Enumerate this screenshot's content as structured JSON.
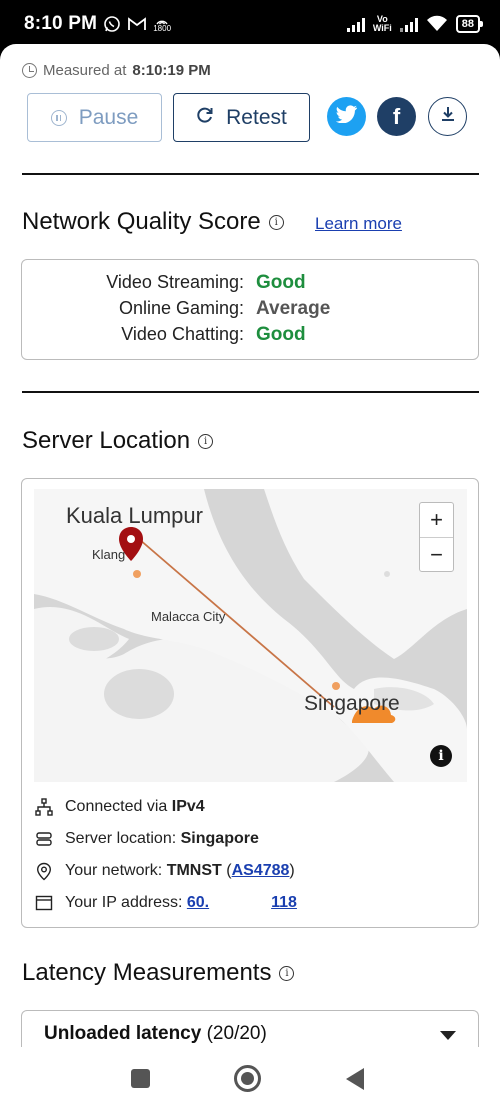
{
  "status_bar": {
    "time": "8:10 PM",
    "network_label": "1800",
    "vowifi_top": "Vo",
    "vowifi_bottom": "WiFi",
    "battery": "88"
  },
  "measured": {
    "prefix": "Measured at",
    "time": "8:10:19 PM"
  },
  "toolbar": {
    "pause_label": "Pause",
    "retest_label": "Retest",
    "facebook_glyph": "f"
  },
  "quality": {
    "title": "Network Quality Score",
    "learn_more": "Learn more",
    "rows": [
      {
        "label": "Video Streaming:",
        "value": "Good",
        "color": "#1e8e3e"
      },
      {
        "label": "Online Gaming:",
        "value": "Average",
        "color": "#555555"
      },
      {
        "label": "Video Chatting:",
        "value": "Good",
        "color": "#1e8e3e"
      }
    ]
  },
  "server": {
    "title": "Server Location",
    "map": {
      "origin_label": "Kuala Lumpur",
      "origin_sub": "Klang",
      "waypoint_label": "Malacca City",
      "destination_label": "Singapore",
      "zoom_in": "+",
      "zoom_out": "−",
      "info": "i"
    },
    "details": {
      "connected_prefix": "Connected via",
      "connected_value": "IPv4",
      "server_prefix": "Server location:",
      "server_value": "Singapore",
      "network_prefix": "Your network:",
      "network_name": "TMNST",
      "network_open": "(",
      "network_asn": "AS4788",
      "network_close": ")",
      "ip_prefix": "Your IP address:",
      "ip_start": "60.",
      "ip_end": "118"
    }
  },
  "latency": {
    "title": "Latency Measurements",
    "accordion_title": "Unloaded latency",
    "accordion_count": "(20/20)"
  },
  "colors": {
    "brand_navy": "#1f3f66",
    "twitter": "#1da1f2",
    "good": "#1e8e3e",
    "link": "#1a3fb0"
  }
}
